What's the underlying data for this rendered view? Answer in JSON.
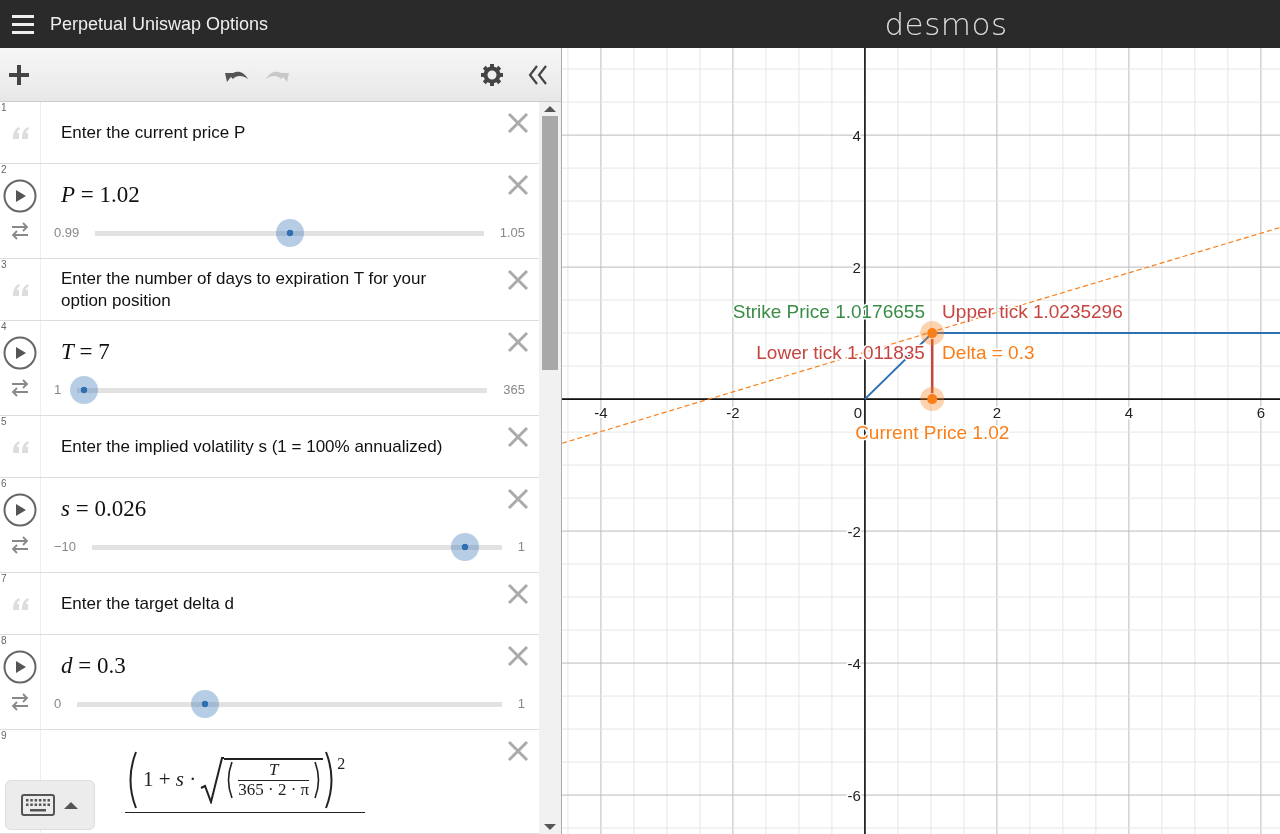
{
  "header": {
    "title": "Perpetual Uniswap Options",
    "logo": "desmos"
  },
  "toolbar": {
    "undo": {
      "disabled": false
    },
    "redo": {
      "disabled": true
    }
  },
  "expressions": [
    {
      "number": "1",
      "kind": "note",
      "text": "Enter the current price P"
    },
    {
      "number": "2",
      "kind": "slider",
      "expression": "*P* = 1.02",
      "min": "0.99",
      "max": "1.05",
      "level": 0.5
    },
    {
      "number": "3",
      "kind": "note",
      "text": "Enter the number of days to expiration T for your option position"
    },
    {
      "number": "4",
      "kind": "slider",
      "expression": "*T* = 7",
      "min": "1",
      "max": "365",
      "level": 0.016
    },
    {
      "number": "5",
      "kind": "note",
      "text": "Enter the implied volatility s (1 = 100% annualized)"
    },
    {
      "number": "6",
      "kind": "slider",
      "expression": "*s* = 0.026",
      "min": "−10",
      "max": "1",
      "level": 0.911
    },
    {
      "number": "7",
      "kind": "note",
      "text": "Enter the target delta d"
    },
    {
      "number": "8",
      "kind": "slider",
      "expression": "*d* = 0.3",
      "min": "0",
      "max": "1",
      "level": 0.3
    },
    {
      "number": "9",
      "kind": "formula",
      "base": "1 + *s* ·",
      "fraction_top": "T",
      "fraction_bottom": "365 · 2 · π",
      "power": "2"
    }
  ],
  "graph": {
    "chart_data": {
      "type": "line",
      "grid": true,
      "xlim": [
        -4.59,
        6.29
      ],
      "ylim": [
        -6.59,
        5.32
      ],
      "xticks": [
        -4,
        -2,
        0,
        2,
        4,
        6
      ],
      "yticks": [
        -6,
        -4,
        -2,
        2,
        4
      ],
      "x": [
        -4.59,
        0,
        1.02,
        6.29
      ],
      "series": [
        {
          "color": "#2d70b3",
          "line_style": "solid",
          "values": [
            null,
            0,
            1,
            1
          ]
        },
        {
          "color": "#fa7e19",
          "line_style": "dashed",
          "values": [
            -0.67,
            0.71,
            1.02,
            2.6
          ]
        },
        {
          "color": "#fa7e19",
          "line_style": "none",
          "marker": true,
          "values": [
            null,
            null,
            0,
            null
          ]
        }
      ],
      "annotations": [
        "Strike Price 1.0176655",
        "Upper tick 1.0235296",
        "Lower tick 1.011835",
        "Delta = 0.3",
        "Current Price 1.02"
      ]
    }
  }
}
